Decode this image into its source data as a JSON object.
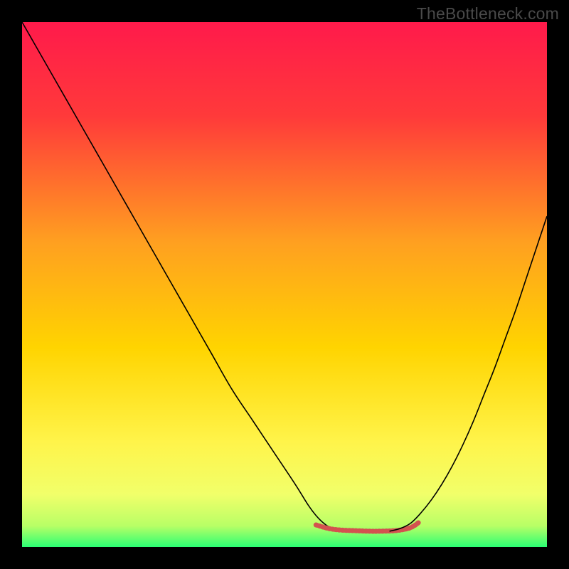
{
  "watermark": "TheBottleneck.com",
  "chart_data": {
    "type": "line",
    "title": "",
    "xlabel": "",
    "ylabel": "",
    "xlim": [
      0,
      100
    ],
    "ylim": [
      0,
      100
    ],
    "grid": false,
    "legend": false,
    "background_gradient": {
      "stops": [
        {
          "offset": 0.0,
          "color": "#ff1a4b"
        },
        {
          "offset": 0.18,
          "color": "#ff3a3a"
        },
        {
          "offset": 0.42,
          "color": "#ffa020"
        },
        {
          "offset": 0.62,
          "color": "#ffd400"
        },
        {
          "offset": 0.8,
          "color": "#fff44a"
        },
        {
          "offset": 0.9,
          "color": "#f1ff6a"
        },
        {
          "offset": 0.96,
          "color": "#b8ff66"
        },
        {
          "offset": 1.0,
          "color": "#2bff74"
        }
      ]
    },
    "series": [
      {
        "name": "left-branch",
        "stroke": "#000000",
        "stroke_width": 1.6,
        "x": [
          0,
          4,
          8,
          12,
          16,
          20,
          24,
          28,
          32,
          36,
          40,
          44,
          48,
          52,
          54.5,
          56,
          57.5,
          59,
          60.5,
          62
        ],
        "y": [
          100,
          93,
          86,
          79,
          72,
          65,
          58,
          51,
          44,
          37,
          30,
          24,
          18,
          12,
          8,
          6,
          4.5,
          3.5,
          3,
          3
        ]
      },
      {
        "name": "valley-floor",
        "stroke": "#d3524f",
        "stroke_width": 7,
        "dash": "1.5 3.2",
        "linecap": "round",
        "x": [
          56,
          58.5,
          61,
          63.5,
          66,
          68.5,
          71,
          72.5,
          73.8,
          74.8,
          75.6
        ],
        "y": [
          4.2,
          3.5,
          3.2,
          3.1,
          3.0,
          3.0,
          3.1,
          3.3,
          3.6,
          4.1,
          4.7
        ]
      },
      {
        "name": "right-branch",
        "stroke": "#000000",
        "stroke_width": 1.6,
        "x": [
          70,
          72,
          74,
          76,
          78,
          80,
          82,
          84,
          86,
          88,
          90,
          92,
          94,
          96,
          98,
          100
        ],
        "y": [
          3,
          3.5,
          4.5,
          6.5,
          9,
          12,
          15.5,
          19.5,
          24,
          29,
          34,
          39.5,
          45,
          51,
          57,
          63
        ]
      }
    ]
  }
}
